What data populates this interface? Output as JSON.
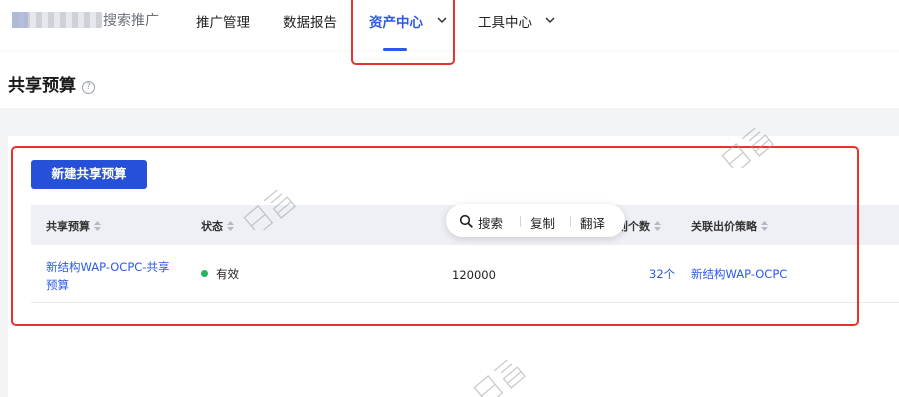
{
  "nav": {
    "brand_suffix": "搜索推广",
    "items": [
      {
        "label": "推广管理",
        "active": false,
        "has_dropdown": false
      },
      {
        "label": "数据报告",
        "active": false,
        "has_dropdown": false
      },
      {
        "label": "资产中心",
        "active": true,
        "has_dropdown": true
      },
      {
        "label": "工具中心",
        "active": false,
        "has_dropdown": true
      }
    ]
  },
  "page": {
    "title": "共享预算",
    "help_icon": "question-circle-icon"
  },
  "toolbar": {
    "new_button_label": "新建共享预算"
  },
  "table": {
    "columns": [
      {
        "label": "共享预算",
        "sortable": true
      },
      {
        "label": "状态",
        "sortable": true
      },
      {
        "label": "则个数",
        "sortable": true
      },
      {
        "label": "关联出价策略",
        "sortable": true
      }
    ],
    "rows": [
      {
        "name_line1": "新结构WAP-OCPC-共享",
        "name_line2": "预算",
        "status": "有效",
        "budget": "120000",
        "count": "32个",
        "strategy": "新结构WAP-OCPC"
      }
    ]
  },
  "context_menu": {
    "items": [
      "搜索",
      "复制",
      "翻译"
    ]
  },
  "colors": {
    "accent": "#2b5ae6",
    "button": "#2650d8",
    "status_ok": "#27b35a",
    "highlight_box": "#e8322b"
  }
}
